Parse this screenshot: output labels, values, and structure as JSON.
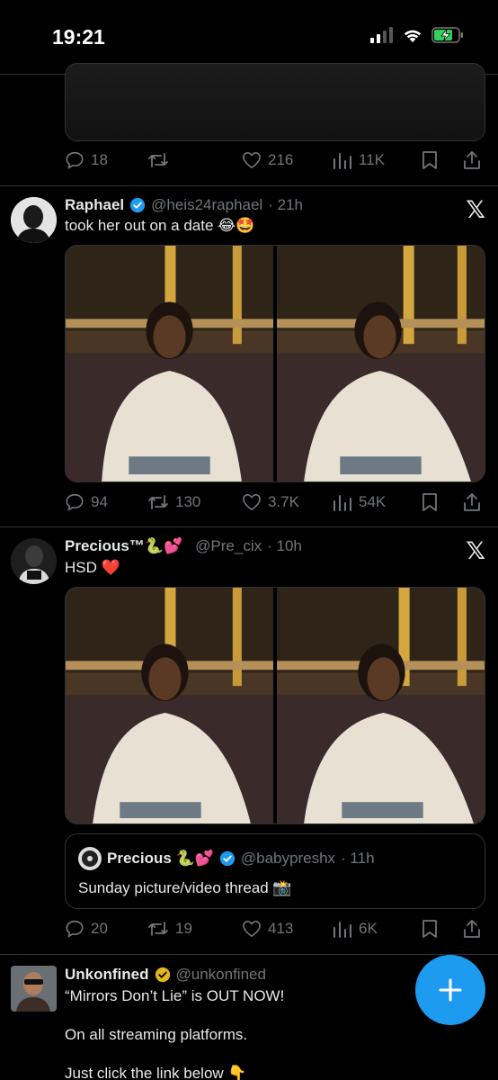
{
  "status_bar": {
    "time": "19:21"
  },
  "colors": {
    "accent": "#1d9bf0",
    "background": "#000000",
    "muted": "#71767b",
    "verified_blue": "#1d9bf0",
    "verified_gold": "#e2b719"
  },
  "tweets": [
    {
      "stats": {
        "replies": "18",
        "retweets": "",
        "likes": "216",
        "views": "11K"
      }
    },
    {
      "display_name": "Raphael",
      "verified": "blue",
      "handle": "@heis24raphael",
      "time": "· 21h",
      "text": "took her out on a date 😂🤩",
      "source_icon": "x-logo-icon",
      "stats": {
        "replies": "94",
        "retweets": "130",
        "likes": "3.7K",
        "views": "54K"
      }
    },
    {
      "display_name": "Precious™🐍💕",
      "verified": "none",
      "handle": "@Pre_cix",
      "time": "· 10h",
      "text": "HSD ❤️",
      "source_icon": "x-logo-icon",
      "quote": {
        "display_name": "Precious 🐍💕",
        "verified": "blue",
        "handle": "@babypreshx",
        "time": "· 11h",
        "text": "Sunday picture/video thread 📸"
      },
      "stats": {
        "replies": "20",
        "retweets": "19",
        "likes": "413",
        "views": "6K"
      }
    },
    {
      "display_name": "Unkonfined",
      "verified": "gold",
      "handle": "@unkonfined",
      "text_lines": [
        "“Mirrors Don’t Lie” is OUT NOW!",
        "On all streaming platforms.",
        "Just click the link below 👇"
      ]
    }
  ],
  "fab": {
    "icon": "plus-icon"
  }
}
